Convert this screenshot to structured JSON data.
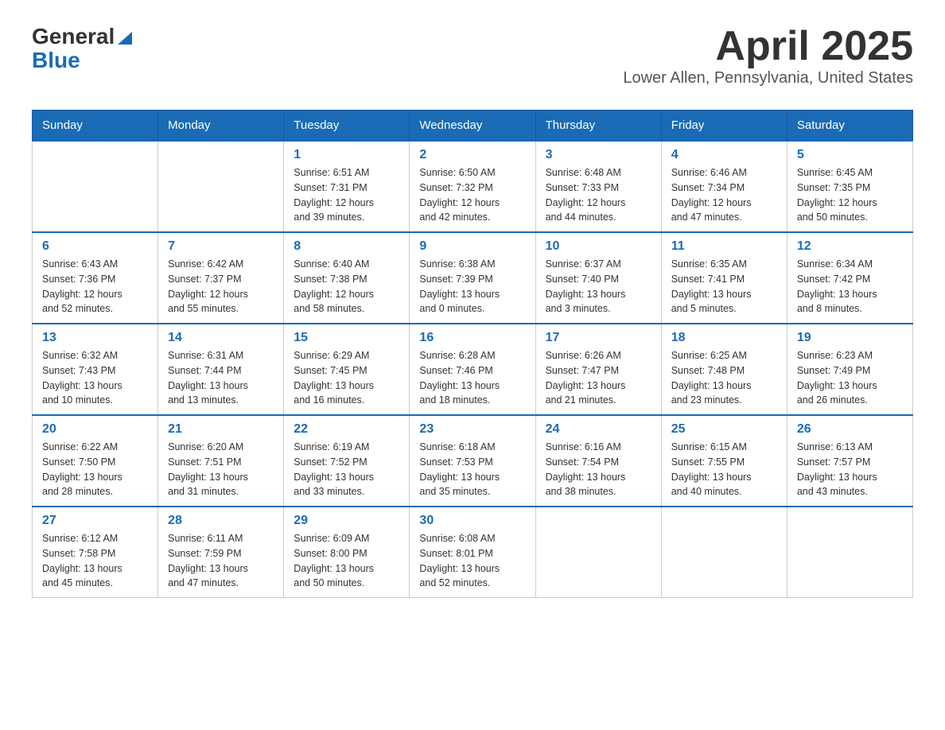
{
  "header": {
    "logo_general": "General",
    "logo_blue": "Blue",
    "month_title": "April 2025",
    "location": "Lower Allen, Pennsylvania, United States"
  },
  "weekdays": [
    "Sunday",
    "Monday",
    "Tuesday",
    "Wednesday",
    "Thursday",
    "Friday",
    "Saturday"
  ],
  "weeks": [
    [
      {
        "day": "",
        "info": ""
      },
      {
        "day": "",
        "info": ""
      },
      {
        "day": "1",
        "info": "Sunrise: 6:51 AM\nSunset: 7:31 PM\nDaylight: 12 hours\nand 39 minutes."
      },
      {
        "day": "2",
        "info": "Sunrise: 6:50 AM\nSunset: 7:32 PM\nDaylight: 12 hours\nand 42 minutes."
      },
      {
        "day": "3",
        "info": "Sunrise: 6:48 AM\nSunset: 7:33 PM\nDaylight: 12 hours\nand 44 minutes."
      },
      {
        "day": "4",
        "info": "Sunrise: 6:46 AM\nSunset: 7:34 PM\nDaylight: 12 hours\nand 47 minutes."
      },
      {
        "day": "5",
        "info": "Sunrise: 6:45 AM\nSunset: 7:35 PM\nDaylight: 12 hours\nand 50 minutes."
      }
    ],
    [
      {
        "day": "6",
        "info": "Sunrise: 6:43 AM\nSunset: 7:36 PM\nDaylight: 12 hours\nand 52 minutes."
      },
      {
        "day": "7",
        "info": "Sunrise: 6:42 AM\nSunset: 7:37 PM\nDaylight: 12 hours\nand 55 minutes."
      },
      {
        "day": "8",
        "info": "Sunrise: 6:40 AM\nSunset: 7:38 PM\nDaylight: 12 hours\nand 58 minutes."
      },
      {
        "day": "9",
        "info": "Sunrise: 6:38 AM\nSunset: 7:39 PM\nDaylight: 13 hours\nand 0 minutes."
      },
      {
        "day": "10",
        "info": "Sunrise: 6:37 AM\nSunset: 7:40 PM\nDaylight: 13 hours\nand 3 minutes."
      },
      {
        "day": "11",
        "info": "Sunrise: 6:35 AM\nSunset: 7:41 PM\nDaylight: 13 hours\nand 5 minutes."
      },
      {
        "day": "12",
        "info": "Sunrise: 6:34 AM\nSunset: 7:42 PM\nDaylight: 13 hours\nand 8 minutes."
      }
    ],
    [
      {
        "day": "13",
        "info": "Sunrise: 6:32 AM\nSunset: 7:43 PM\nDaylight: 13 hours\nand 10 minutes."
      },
      {
        "day": "14",
        "info": "Sunrise: 6:31 AM\nSunset: 7:44 PM\nDaylight: 13 hours\nand 13 minutes."
      },
      {
        "day": "15",
        "info": "Sunrise: 6:29 AM\nSunset: 7:45 PM\nDaylight: 13 hours\nand 16 minutes."
      },
      {
        "day": "16",
        "info": "Sunrise: 6:28 AM\nSunset: 7:46 PM\nDaylight: 13 hours\nand 18 minutes."
      },
      {
        "day": "17",
        "info": "Sunrise: 6:26 AM\nSunset: 7:47 PM\nDaylight: 13 hours\nand 21 minutes."
      },
      {
        "day": "18",
        "info": "Sunrise: 6:25 AM\nSunset: 7:48 PM\nDaylight: 13 hours\nand 23 minutes."
      },
      {
        "day": "19",
        "info": "Sunrise: 6:23 AM\nSunset: 7:49 PM\nDaylight: 13 hours\nand 26 minutes."
      }
    ],
    [
      {
        "day": "20",
        "info": "Sunrise: 6:22 AM\nSunset: 7:50 PM\nDaylight: 13 hours\nand 28 minutes."
      },
      {
        "day": "21",
        "info": "Sunrise: 6:20 AM\nSunset: 7:51 PM\nDaylight: 13 hours\nand 31 minutes."
      },
      {
        "day": "22",
        "info": "Sunrise: 6:19 AM\nSunset: 7:52 PM\nDaylight: 13 hours\nand 33 minutes."
      },
      {
        "day": "23",
        "info": "Sunrise: 6:18 AM\nSunset: 7:53 PM\nDaylight: 13 hours\nand 35 minutes."
      },
      {
        "day": "24",
        "info": "Sunrise: 6:16 AM\nSunset: 7:54 PM\nDaylight: 13 hours\nand 38 minutes."
      },
      {
        "day": "25",
        "info": "Sunrise: 6:15 AM\nSunset: 7:55 PM\nDaylight: 13 hours\nand 40 minutes."
      },
      {
        "day": "26",
        "info": "Sunrise: 6:13 AM\nSunset: 7:57 PM\nDaylight: 13 hours\nand 43 minutes."
      }
    ],
    [
      {
        "day": "27",
        "info": "Sunrise: 6:12 AM\nSunset: 7:58 PM\nDaylight: 13 hours\nand 45 minutes."
      },
      {
        "day": "28",
        "info": "Sunrise: 6:11 AM\nSunset: 7:59 PM\nDaylight: 13 hours\nand 47 minutes."
      },
      {
        "day": "29",
        "info": "Sunrise: 6:09 AM\nSunset: 8:00 PM\nDaylight: 13 hours\nand 50 minutes."
      },
      {
        "day": "30",
        "info": "Sunrise: 6:08 AM\nSunset: 8:01 PM\nDaylight: 13 hours\nand 52 minutes."
      },
      {
        "day": "",
        "info": ""
      },
      {
        "day": "",
        "info": ""
      },
      {
        "day": "",
        "info": ""
      }
    ]
  ]
}
